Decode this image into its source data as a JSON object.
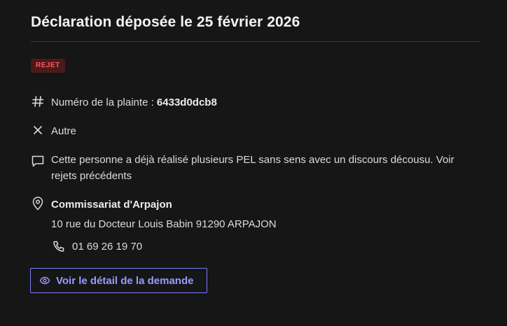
{
  "header": {
    "title": "Déclaration déposée le 25 février 2026"
  },
  "status": {
    "badge": "REJET",
    "badge_bg": "#4a1a1a",
    "badge_color": "#ff5a5a"
  },
  "complaint": {
    "number_label": "Numéro de la plainte :",
    "number_value": "6433d0dcb8",
    "number_icon": "hash-icon",
    "category": "Autre",
    "category_icon": "close-icon",
    "comment": "Cette personne a déjà réalisé plusieurs PEL sans sens avec un discours décousu. Voir rejets précédents",
    "comment_icon": "comment-icon"
  },
  "location": {
    "icon": "location-pin-icon",
    "name": "Commissariat d'Arpajon",
    "address": "10 rue du Docteur Louis Babin 91290 ARPAJON",
    "phone": "01 69 26 19 70",
    "phone_icon": "phone-icon"
  },
  "action": {
    "label": "Voir le détail de la demande",
    "icon": "eye-icon",
    "accent": "#7c7cff"
  }
}
